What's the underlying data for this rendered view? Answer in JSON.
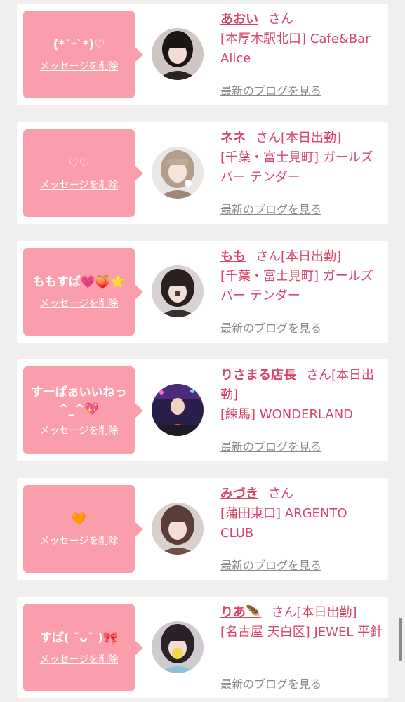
{
  "delete_label": "メッセージを削除",
  "blog_label": "最新のブログを見る",
  "san_label": "さん",
  "colors": {
    "bubble": "#fb9eac",
    "accent": "#d74467",
    "link_gray": "#8a8a8a",
    "background": "#f0efee"
  },
  "messages": [
    {
      "text": "(*ˊᵕˋ*)♡",
      "name": "あおい",
      "suffix": "",
      "location": "[本厚木駅北口] Cafe&Bar Alice",
      "avatar_icon": "girl-avatar-1"
    },
    {
      "text": "♡♡",
      "name": "ネネ",
      "suffix": "[本日出勤]",
      "location": "[千葉・富士見町] ガールズバー テンダー",
      "avatar_icon": "girl-avatar-2"
    },
    {
      "text": "ももすぱ💗🍑⭐",
      "name": "もも",
      "suffix": "[本日出勤]",
      "location": "[千葉・富士見町] ガールズバー テンダー",
      "avatar_icon": "girl-avatar-3"
    },
    {
      "text": "すーぱぁいいねっ^_^💖",
      "name": "りさまる店長",
      "suffix": "[本日出勤]",
      "location": "[練馬] WONDERLAND",
      "avatar_icon": "girl-avatar-4"
    },
    {
      "text": "🧡",
      "name": "みづき",
      "suffix": "",
      "location": "[蒲田東口] ARGENTO CLUB",
      "avatar_icon": "girl-avatar-5"
    },
    {
      "text": "すぱ( ˘ᴗ˘ )🎀",
      "name": "りあ🪶",
      "suffix": "[本日出勤]",
      "location": "[名古屋 天白区] JEWEL 平針",
      "avatar_icon": "girl-avatar-6"
    }
  ]
}
